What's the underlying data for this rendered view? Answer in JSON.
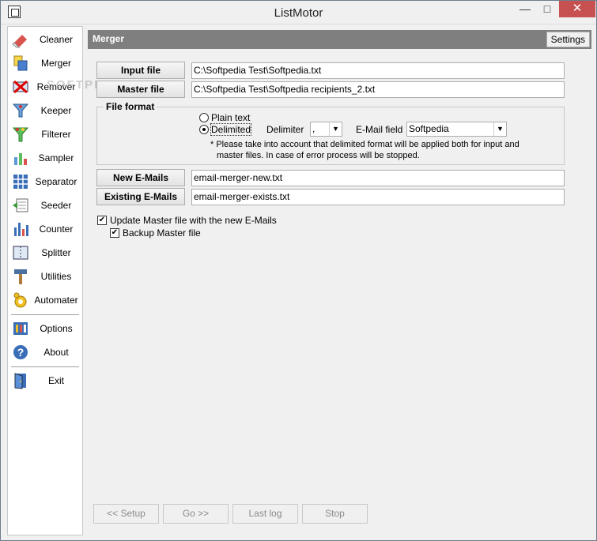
{
  "window": {
    "title": "ListMotor"
  },
  "titlebar": {
    "min": "—",
    "max": "□",
    "close": "✕"
  },
  "watermark": "SOFTPEDIA",
  "sidebar": {
    "items": [
      {
        "label": "Cleaner",
        "icon": "eraser-icon"
      },
      {
        "label": "Merger",
        "icon": "merge-icon"
      },
      {
        "label": "Remover",
        "icon": "remove-icon"
      },
      {
        "label": "Keeper",
        "icon": "keeper-icon"
      },
      {
        "label": "Filterer",
        "icon": "filter-icon"
      },
      {
        "label": "Sampler",
        "icon": "sampler-icon"
      },
      {
        "label": "Separator",
        "icon": "grid-icon"
      },
      {
        "label": "Seeder",
        "icon": "seeder-icon"
      },
      {
        "label": "Counter",
        "icon": "chart-icon"
      },
      {
        "label": "Splitter",
        "icon": "splitter-icon"
      },
      {
        "label": "Utilities",
        "icon": "hammer-icon"
      },
      {
        "label": "Automater",
        "icon": "gear-icon"
      },
      {
        "label": "Options",
        "icon": "options-icon"
      },
      {
        "label": "About",
        "icon": "help-icon"
      },
      {
        "label": "Exit",
        "icon": "door-icon"
      }
    ]
  },
  "panel": {
    "title": "Merger",
    "settings": "Settings"
  },
  "input_file": {
    "button": "Input file",
    "value": "C:\\Softpedia Test\\Softpedia.txt"
  },
  "master_file": {
    "button": "Master file",
    "value": "C:\\Softpedia Test\\Softpedia recipients_2.txt"
  },
  "file_format": {
    "title": "File format",
    "plain_text": "Plain text",
    "delimited": "Delimited",
    "selected": "Delimited",
    "delimiter_label": "Delimiter",
    "delimiter_value": ",",
    "email_field_label": "E-Mail field",
    "email_field_value": "Softpedia",
    "note_line1": "* Please take into account that delimited format will be applied both for input and",
    "note_line2": "master files. In case of error process will be stopped."
  },
  "new_emails": {
    "button": "New E-Mails",
    "value": "email-merger-new.txt"
  },
  "existing_emails": {
    "button": "Existing E-Mails",
    "value": "email-merger-exists.txt"
  },
  "options": {
    "update_master": "Update Master file with the new E-Mails",
    "update_master_checked": true,
    "backup_master": "Backup Master file",
    "backup_master_checked": true
  },
  "bottom": {
    "setup": "<< Setup",
    "go": "Go >>",
    "last_log": "Last log",
    "stop": "Stop"
  },
  "colors": {
    "header": "#7f7f7f",
    "close": "#c75050"
  }
}
